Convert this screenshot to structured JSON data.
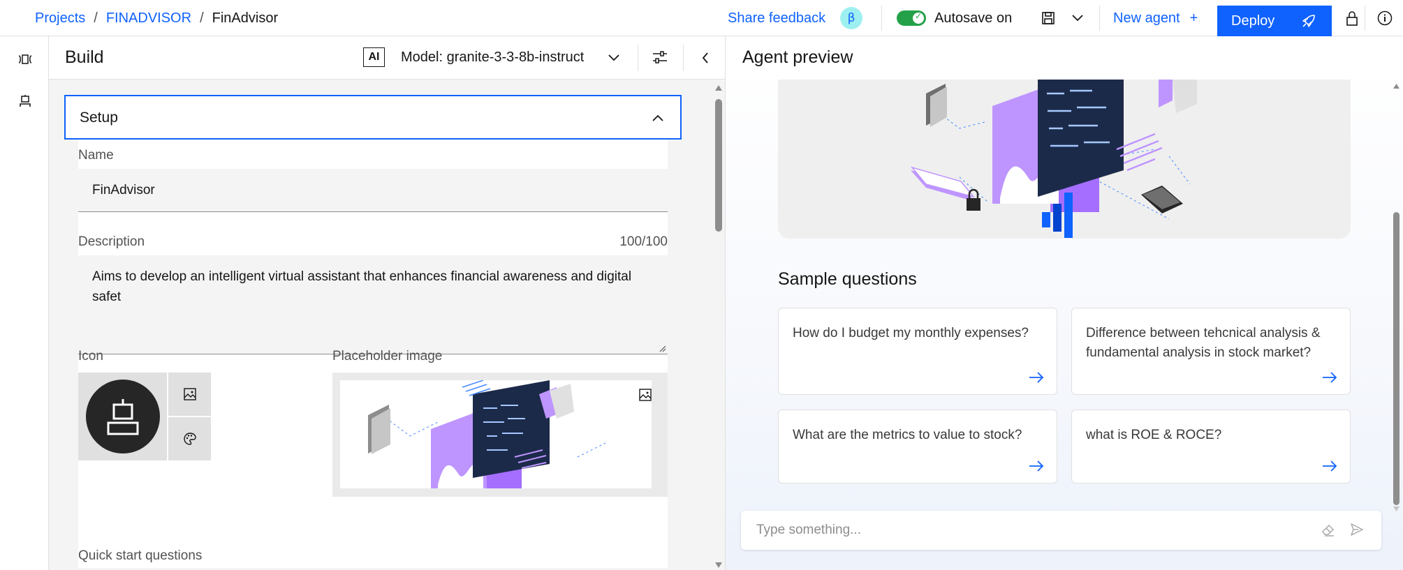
{
  "breadcrumb": {
    "projects": "Projects",
    "sep": "/",
    "project": "FINADVISOR",
    "current": "FinAdvisor"
  },
  "topbar": {
    "share_feedback": "Share feedback",
    "beta_badge": "β",
    "autosave_label": "Autosave on",
    "new_agent": "New agent",
    "new_agent_plus": "+",
    "deploy": "Deploy"
  },
  "build": {
    "title": "Build",
    "ai_badge": "AI",
    "model_label": "Model: granite-3-3-8b-instruct",
    "setup_title": "Setup",
    "name_label": "Name",
    "name_value": "FinAdvisor",
    "description_label": "Description",
    "description_count": "100/100",
    "description_value": "Aims to develop an intelligent virtual assistant that enhances financial awareness and digital safet",
    "icon_label": "Icon",
    "placeholder_label": "Placeholder image",
    "quick_start_label": "Quick start questions"
  },
  "preview": {
    "title": "Agent preview",
    "sample_title": "Sample questions",
    "questions": [
      "How do I budget my monthly expenses?",
      "Difference between tehcnical analysis & fundamental analysis in stock market?",
      "What are the metrics to value to stock?",
      "what is ROE & ROCE?"
    ],
    "chat_placeholder": "Type something..."
  },
  "colors": {
    "accent": "#0f62fe",
    "toggle_on": "#24a148",
    "illustration_purple": "#a56eff"
  }
}
